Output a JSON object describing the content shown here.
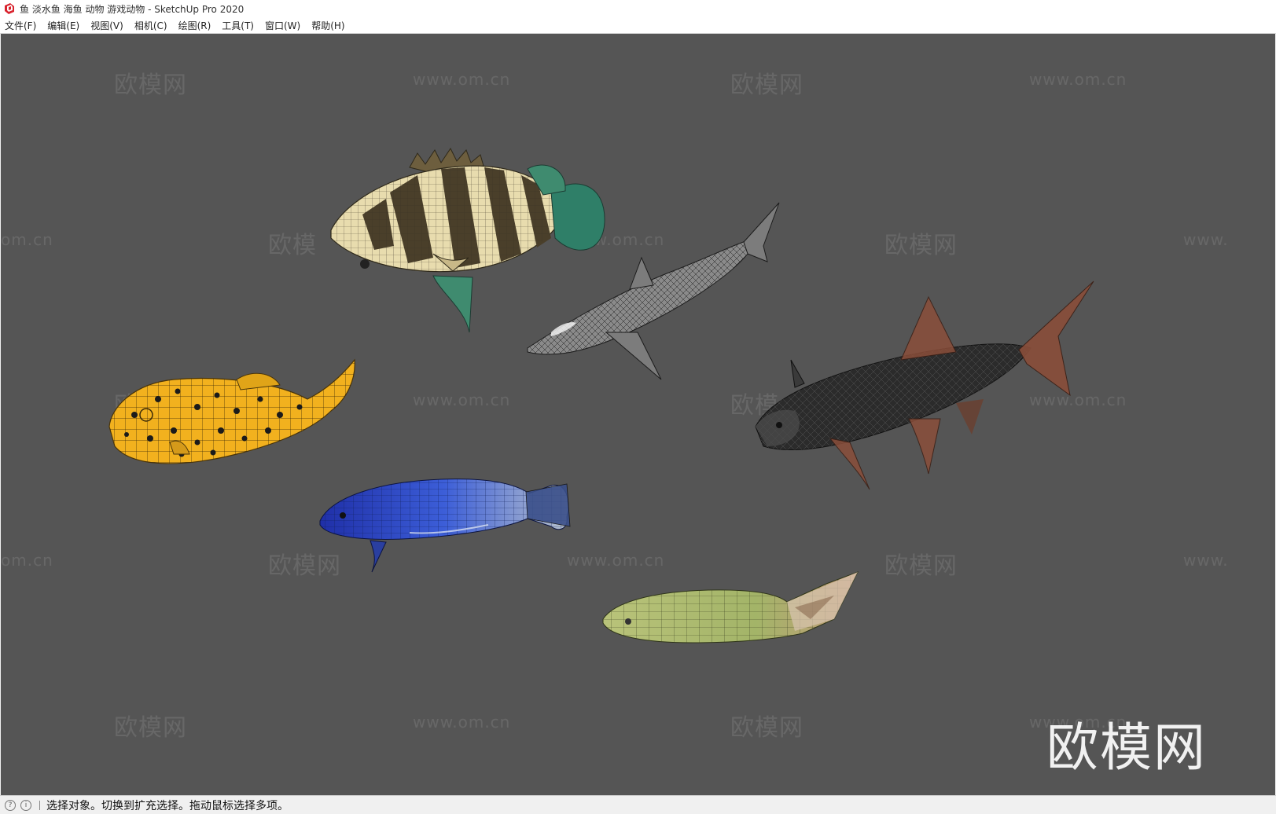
{
  "window": {
    "title": "鱼 淡水鱼 海鱼 动物 游戏动物 - SketchUp Pro 2020",
    "icon": "sketchup-logo-icon"
  },
  "menu": {
    "items": [
      {
        "label": "文件(F)"
      },
      {
        "label": "编辑(E)"
      },
      {
        "label": "视图(V)"
      },
      {
        "label": "相机(C)"
      },
      {
        "label": "绘图(R)"
      },
      {
        "label": "工具(T)"
      },
      {
        "label": "窗口(W)"
      },
      {
        "label": "帮助(H)"
      }
    ]
  },
  "viewport": {
    "background": "#555555",
    "watermark_cn": "欧模网",
    "watermark_url": "www.om.cn",
    "watermark_partial_url_left": "om.cn",
    "watermark_partial_url_right": "www.",
    "watermark_partial_cn": "欧模",
    "big_logo": "欧模网",
    "models": [
      {
        "name": "striped-grouper",
        "colors": [
          "#e8dcae",
          "#4a3f2a",
          "#2f7f68"
        ]
      },
      {
        "name": "shark",
        "colors": [
          "#8a8a8a",
          "#222222"
        ]
      },
      {
        "name": "yellow-boxfish",
        "colors": [
          "#f2b11e",
          "#1b1b1b"
        ]
      },
      {
        "name": "dark-carp",
        "colors": [
          "#2b2b2b",
          "#8a4e3a"
        ]
      },
      {
        "name": "blue-cichlid",
        "colors": [
          "#2a42c8",
          "#9aa7b8"
        ]
      },
      {
        "name": "green-wrasse",
        "colors": [
          "#a8b86a",
          "#c8a080"
        ]
      }
    ]
  },
  "status": {
    "icons": [
      "help-circle-icon",
      "info-circle-icon"
    ],
    "text": "选择对象。切换到扩充选择。拖动鼠标选择多项。"
  }
}
